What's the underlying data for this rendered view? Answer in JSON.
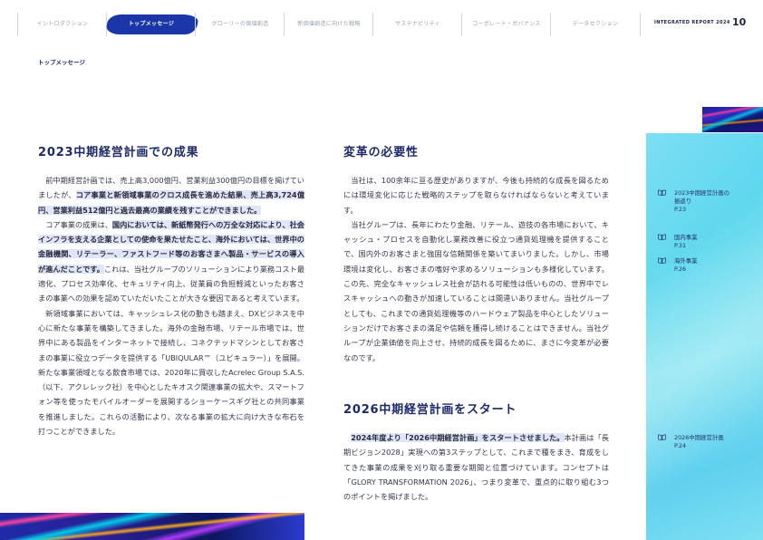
{
  "nav": {
    "items": [
      "イントロダクション",
      "トップメッセージ",
      "グローリーの価値創造",
      "新価値創造に向けた戦略",
      "サステナビリティ",
      "コーポレート・ガバナンス",
      "データセクション"
    ],
    "active_index": 1
  },
  "header": {
    "report_title": "INTEGRATED REPORT 2024",
    "page_number": "10"
  },
  "section_label": "トップメッセージ",
  "left": {
    "heading": "2023中期経営計画での成果",
    "p1_a": "前中期経営計画では、売上高3,000億円、営業利益300億円の目標を掲げていましたが、",
    "p1_hl": "コア事業と新領域事業のクロス成長を進めた結果、売上高3,724億円、営業利益512億円と過去最高の業績を残すことができました。",
    "p2_a": "コア事業の成果は、",
    "p2_hl": "国内においては、新紙幣発行への万全な対応により、社会インフラを支える企業としての使命を果たせたこと、海外においては、世界中の金融機関、リテーラー、ファストフード等のお客さまへ製品・サービスの導入が進んだことです。",
    "p2_b": "これは、当社グループのソリューションにより業務コスト最適化、プロセス効率化、セキュリティ向上、従業員の負担軽減といったお客さまの事業への効果を認めていただいたことが大きな要因であると考えています。",
    "p3": "新領域事業においては、キャッシュレス化の動きも踏まえ、DXビジネスを中心に新たな事業を構築してきました。海外の金融市場、リテール市場では、世界中にある製品をインターネットで接続し、コネクテッドマシンとしてお客さまの事業に役立つデータを提供する「UBIQULAR™（ユビキュラー）」を展開。新たな事業領域となる飲食市場では、2020年に買収したAcrelec Group S.A.S.（以下、アクレレック社）を中心としたキオスク関連事業の拡大や、スマートフォン等を使ったモバイルオーダーを展開するショーケースギグ社との共同事業を推進しました。これらの活動により、次なる事業の拡大に向け大きな布石を打つことができました。"
  },
  "right": {
    "heading1": "変革の必要性",
    "p1": "当社は、100余年に亘る歴史がありますが、今後も持続的な成長を図るためには環境変化に応じた戦略的ステップを取らなければならないと考えています。",
    "p2": "当社グループは、長年にわたり金融、リテール、遊技の各市場において、キャッシュ・プロセスを自動化し業務改善に役立つ通貨処理機を提供することで、国内外のお客さまと強固な信頼関係を築いてまいりました。しかし、市場環境は変化し、お客さまの嗜好や求めるソリューションも多様化しています。この先、完全なキャッシュレス社会が訪れる可能性は低いものの、世界中でレスキャッシュへの動きが加速していることは間違いありません。当社グループとしても、これまでの通貨処理機等のハードウェア製品を中心としたソリューションだけでお客さまの満足や信頼を獲得し続けることはできません。当社グループが企業価値を向上させ、持続的成長を図るために、まさに今変革が必要なのです。",
    "heading2": "2026中期経営計画をスタート",
    "p3_hl": "2024年度より「2026中期経営計画」をスタートさせました。",
    "p3_b": "本計画は「長期ビジョン2028」実現への第3ステップとして、これまで種をまき、育成をしてきた事業の成果を刈り取る重要な期間と位置づけています。コンセプトは「GLORY TRANSFORMATION 2026」、つまり変革で、重点的に取り組む3つのポイントを掲げました。"
  },
  "side_links": [
    {
      "label": "2023中期経営計画の\n振返り",
      "page": "P.23"
    },
    {
      "label": "国内事業",
      "page": "P.31"
    },
    {
      "label": "海外事業",
      "page": "P.26"
    },
    {
      "label": "2026中期経営計画",
      "page": "P.24"
    }
  ],
  "colors": {
    "accent_navy": "#1c2a6b",
    "highlight_bg": "#dfe6f8",
    "side_panel": "#63d9ee",
    "nav_active": "#1b36a8"
  }
}
